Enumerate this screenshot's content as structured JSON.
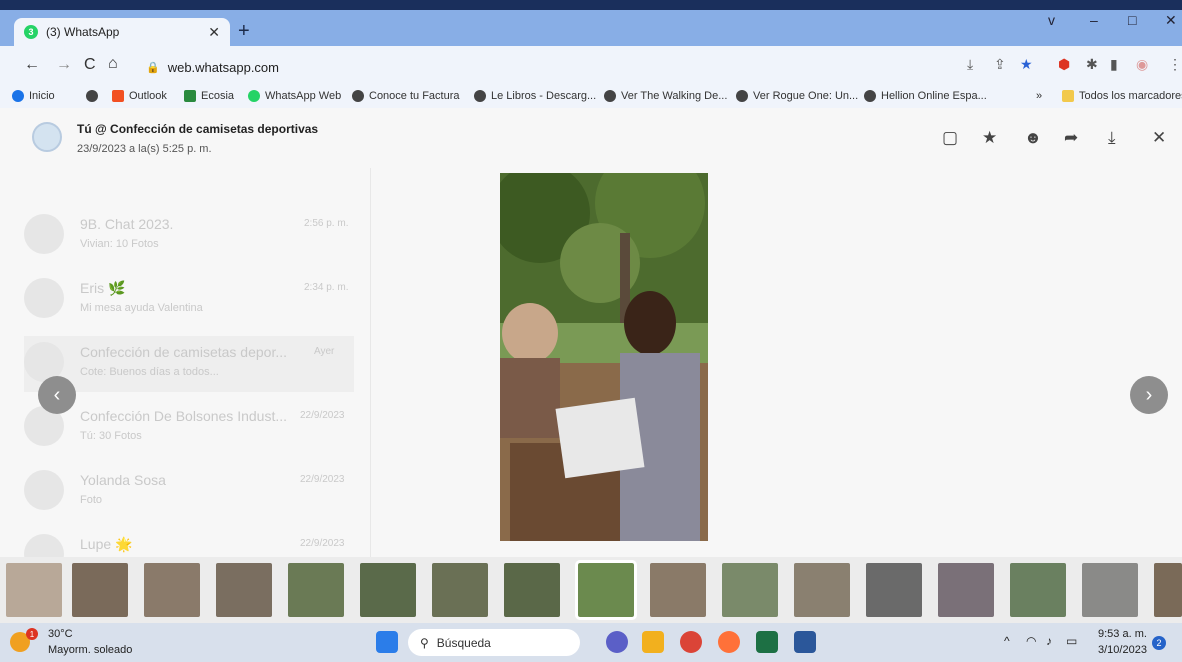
{
  "browser": {
    "tab_title": "(3) WhatsApp",
    "tab_badge": "3",
    "url": "web.whatsapp.com",
    "window_controls": [
      "v",
      "–",
      "□",
      "✕"
    ]
  },
  "bookmarks": [
    "Inicio",
    "Outlook",
    "Ecosia",
    "WhatsApp Web",
    "Conoce tu Factura",
    "Le Libros - Descarg...",
    "Ver The Walking De...",
    "Ver Rogue One: Un...",
    "Hellion Online Espa..."
  ],
  "bookmarks_overflow": "»",
  "bookmarks_all": "Todos los marcadores",
  "viewer": {
    "title": "Tú @ Confección de camisetas deportivas",
    "date": "23/9/2023 a la(s) 5:25 p. m."
  },
  "backdrop_chats": [
    {
      "name": "9B. Chat 2023.",
      "preview": "Vivian: 10 Fotos",
      "time": "2:56 p. m."
    },
    {
      "name": "Eris 🌿",
      "preview": "Mi mesa ayuda Valentina",
      "time": "2:34 p. m."
    },
    {
      "name": "Confección de camisetas depor...",
      "preview": "Cote: Buenos días a todos...",
      "time": "Ayer"
    },
    {
      "name": "Confección De Bolsones Indust...",
      "preview": "Tú: 30 Fotos",
      "time": "22/9/2023"
    },
    {
      "name": "Yolanda Sosa",
      "preview": "Foto",
      "time": "22/9/2023"
    },
    {
      "name": "Lupe 🌟",
      "preview": "",
      "time": "22/9/2023"
    }
  ],
  "taskbar": {
    "temperature": "30°C",
    "weather": "Mayorm. soleado",
    "weather_badge": "1",
    "search_placeholder": "Búsqueda",
    "time": "9:53 a. m.",
    "date": "3/10/2023",
    "notifications": "2"
  },
  "colors": {
    "whatsapp_green": "#25d366",
    "chrome_tabstrip": "#88aee6",
    "taskbar_bg": "#d8e0ec"
  }
}
